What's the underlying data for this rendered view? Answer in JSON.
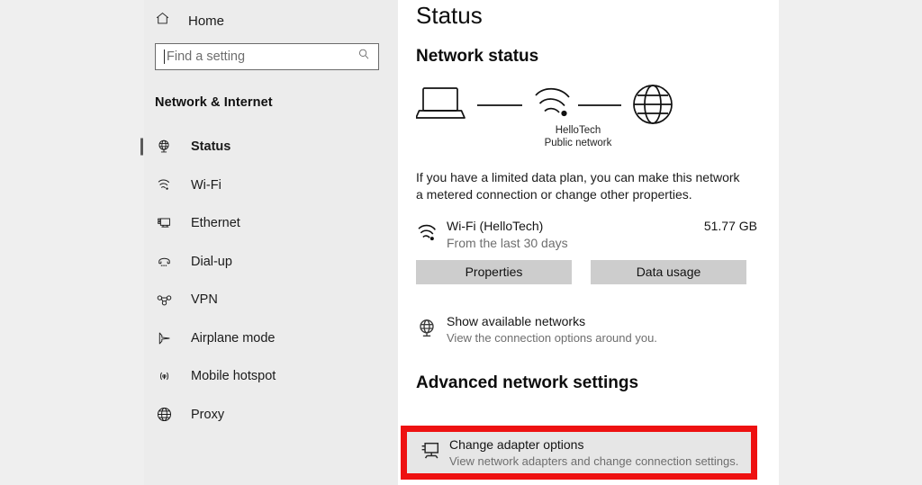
{
  "sidebar": {
    "home": {
      "label": "Home",
      "icon": "home-icon"
    },
    "search": {
      "placeholder": "Find a setting",
      "value": "",
      "icon": "search-icon"
    },
    "category_title": "Network & Internet",
    "items": [
      {
        "label": "Status",
        "icon": "globe-stand-icon",
        "selected": true
      },
      {
        "label": "Wi-Fi",
        "icon": "wifi-icon",
        "selected": false
      },
      {
        "label": "Ethernet",
        "icon": "ethernet-icon",
        "selected": false
      },
      {
        "label": "Dial-up",
        "icon": "dialup-phone-icon",
        "selected": false
      },
      {
        "label": "VPN",
        "icon": "vpn-icon",
        "selected": false
      },
      {
        "label": "Airplane mode",
        "icon": "airplane-icon",
        "selected": false
      },
      {
        "label": "Mobile hotspot",
        "icon": "hotspot-icon",
        "selected": false
      },
      {
        "label": "Proxy",
        "icon": "globe-icon",
        "selected": false
      }
    ]
  },
  "main": {
    "page_title": "Status",
    "network_status_heading": "Network status",
    "diagram": {
      "device_icon": "laptop-icon",
      "connection_icon": "wifi-icon",
      "internet_icon": "globe-icon",
      "network_name": "HelloTech",
      "network_type": "Public network"
    },
    "metered_blurb": "If you have a limited data plan, you can make this network a metered connection or change other properties.",
    "usage": {
      "icon": "wifi-icon",
      "name": "Wi-Fi (HelloTech)",
      "period": "From the last 30 days",
      "amount": "51.77 GB"
    },
    "buttons": {
      "properties": "Properties",
      "data_usage": "Data usage"
    },
    "show_networks": {
      "icon": "globe-stand-icon",
      "title": "Show available networks",
      "subtitle": "View the connection options around you."
    },
    "advanced_heading": "Advanced network settings",
    "adapter_options": {
      "icon": "monitor-network-icon",
      "title": "Change adapter options",
      "subtitle": "View network adapters and change connection settings."
    }
  },
  "colors": {
    "highlight": "#ee1111",
    "sidebar_bg": "#ececec",
    "content_bg": "#ffffff",
    "button_bg": "#cdcdcd"
  }
}
